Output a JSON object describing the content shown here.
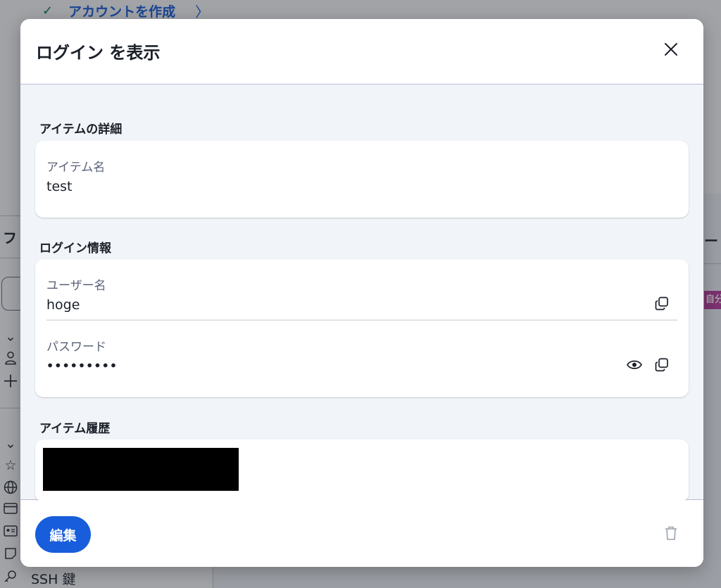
{
  "background": {
    "banner_text": "アカウントを作成",
    "banner_check": "✓",
    "banner_chevron": "〉",
    "sidebar_title": "フ",
    "ssh_label": "SSH 鍵",
    "right_heading": "ー",
    "right_badge": "自分"
  },
  "dialog": {
    "title": "ログイン を表示",
    "close_icon": "close-icon",
    "sections": {
      "item_details": {
        "title": "アイテムの詳細",
        "name_label": "アイテム名",
        "name_value": "test"
      },
      "login_info": {
        "title": "ログイン情報",
        "username_label": "ユーザー名",
        "username_value": "hoge",
        "password_label": "パスワード",
        "password_value": "•••••••••"
      },
      "item_history": {
        "title": "アイテム履歴"
      }
    },
    "footer": {
      "edit_label": "編集",
      "delete_icon": "trash-icon"
    }
  },
  "colors": {
    "accent": "#175ddc",
    "overlay": "#1e242d",
    "body_bg": "#f1f4f8",
    "label": "#5a6178"
  }
}
